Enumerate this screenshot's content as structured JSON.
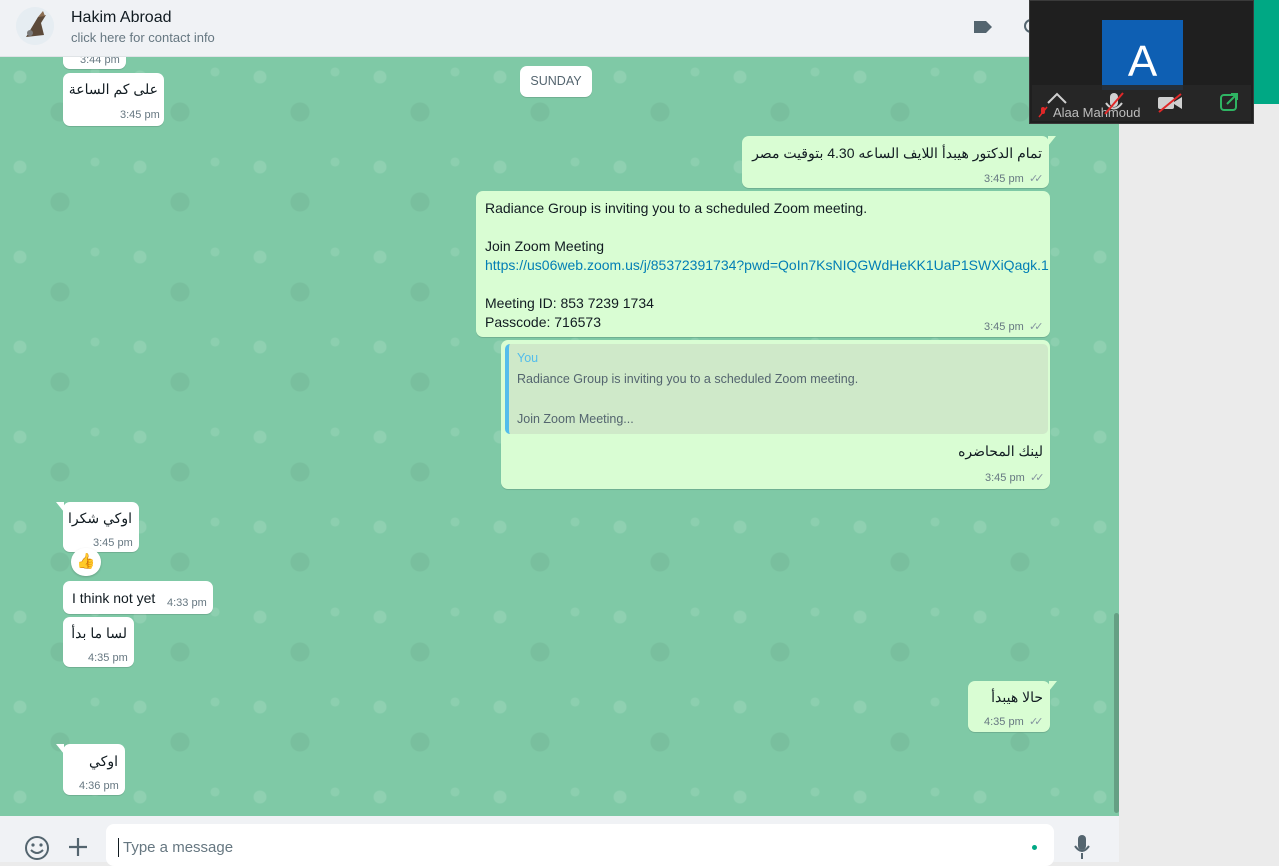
{
  "header": {
    "contact_name": "Hakim Abroad",
    "contact_subtitle": "click here for contact info",
    "icons": [
      "avatar",
      "label-icon",
      "search-icon"
    ]
  },
  "chat": {
    "date_divider": "SUNDAY",
    "messages": [
      {
        "id": "m0",
        "direction": "incoming",
        "text": "",
        "time": "3:44 pm"
      },
      {
        "id": "m1",
        "direction": "incoming",
        "text": "على كم الساعة",
        "time": "3:45 pm"
      },
      {
        "id": "m2",
        "direction": "outgoing",
        "text": "تمام الدكتور هيبدأ اللايف الساعه 4.30 بتوقيت مصر",
        "time": "3:45 pm",
        "status": "read"
      },
      {
        "id": "m3",
        "direction": "outgoing",
        "lines": [
          "Radiance Group is inviting you to a scheduled Zoom meeting.",
          "Join Zoom Meeting",
          "https://us06web.zoom.us/j/85372391734?pwd=QoIn7KsNIQGWdHeKK1UaP1SWXiQagk.1",
          "Meeting ID: 853 7239 1734",
          "Passcode: 716573"
        ],
        "time": "3:45 pm",
        "status": "read"
      },
      {
        "id": "m4",
        "direction": "outgoing",
        "quote": {
          "author": "You",
          "line1": "Radiance Group is inviting you to a scheduled Zoom meeting.",
          "line2": "Join Zoom Meeting..."
        },
        "text": "لينك المحاضره",
        "time": "3:45 pm",
        "status": "read"
      },
      {
        "id": "m5",
        "direction": "incoming",
        "text": "اوكي شكرا",
        "time": "3:45 pm",
        "reaction": "👍"
      },
      {
        "id": "m6",
        "direction": "incoming",
        "text": "I think not yet",
        "time": "4:33 pm"
      },
      {
        "id": "m7",
        "direction": "incoming",
        "text": "لسا ما بدأ",
        "time": "4:35 pm"
      },
      {
        "id": "m8",
        "direction": "outgoing",
        "text": "حالا هيبدأ",
        "time": "4:35 pm",
        "status": "read"
      },
      {
        "id": "m9",
        "direction": "incoming",
        "text": "اوكي",
        "time": "4:36 pm"
      }
    ]
  },
  "composer": {
    "placeholder": "Type a message",
    "icons": [
      "emoji-icon",
      "attach-plus-icon",
      "microphone-icon"
    ]
  },
  "zoom_overlay": {
    "avatar_letter": "A",
    "participant_name": "Alaa Mahmoud",
    "tile_color": "#0e5fb3",
    "controls": [
      "chevron-up-icon",
      "microphone-muted-icon",
      "video-off-icon",
      "share-icon"
    ]
  },
  "colors": {
    "chat_background": "#7fc9a6",
    "outgoing_bubble": "#d9fdd3",
    "incoming_bubble": "#ffffff",
    "link": "#027eb5",
    "quote_bar": "#53bdeb",
    "accent_green": "#00a884"
  }
}
